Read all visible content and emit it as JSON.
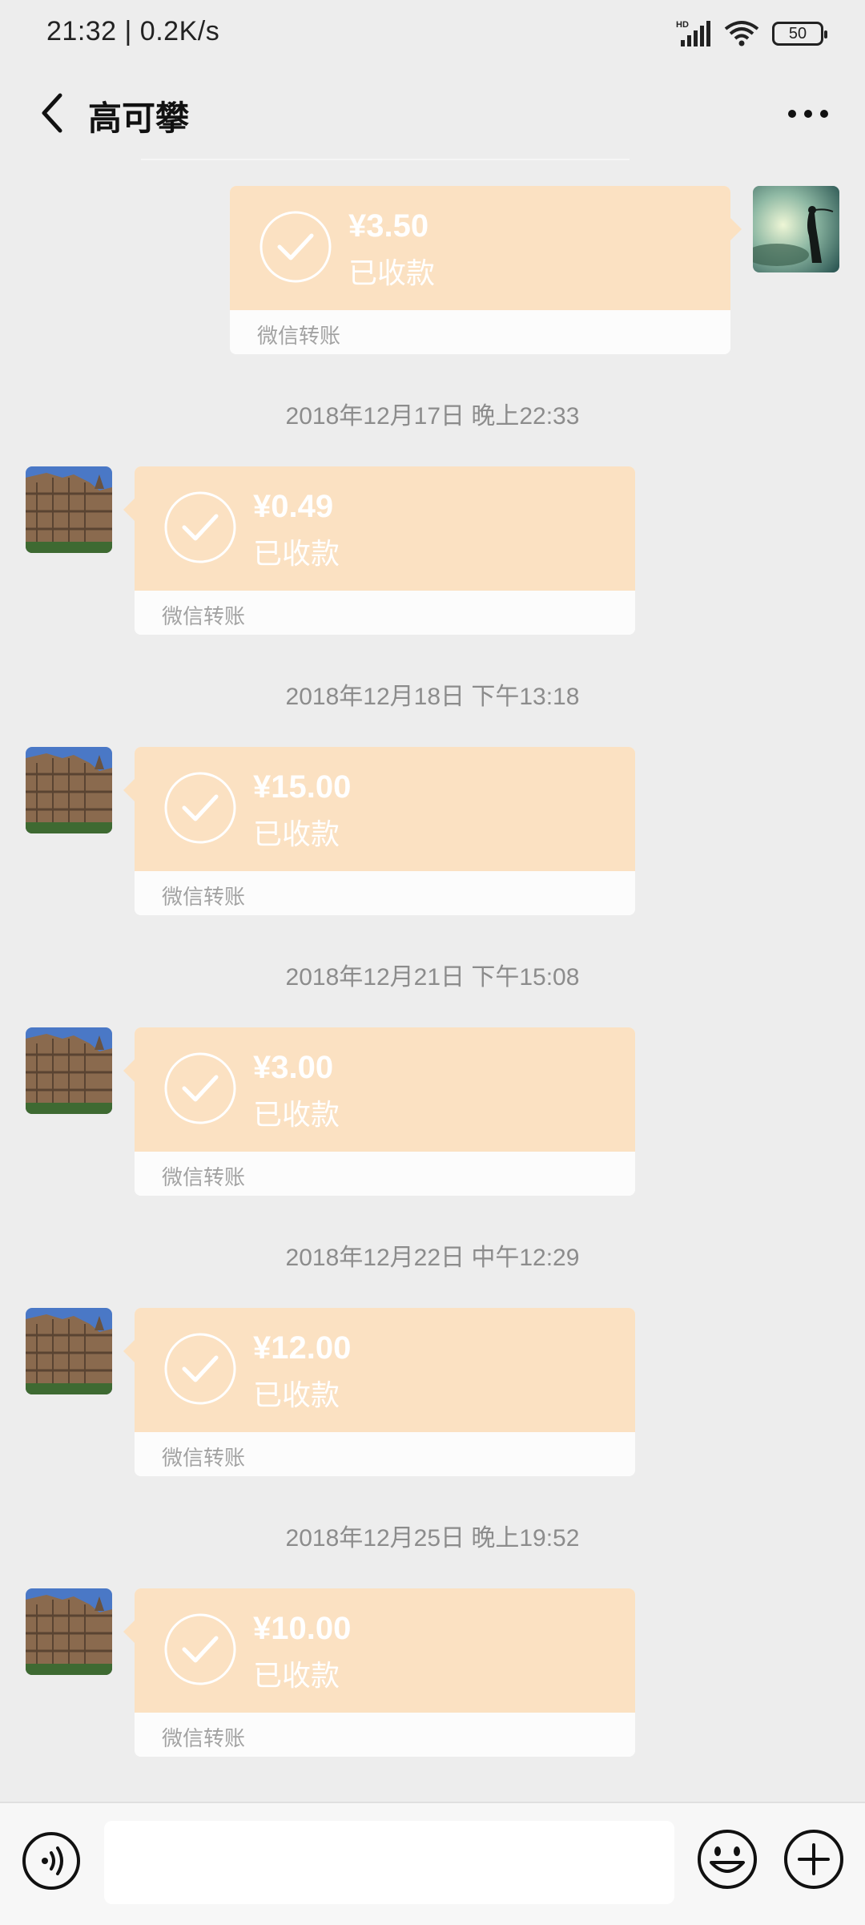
{
  "status_bar": {
    "time_speed": "21:32 | 0.2K/s",
    "battery": "50",
    "network_badge": "HD"
  },
  "header": {
    "title": "高可攀"
  },
  "messages": [
    {
      "amount": "¥3.50",
      "status": "已收款",
      "label": "微信转账"
    },
    {
      "timestamp": "2018年12月17日 晚上22:33",
      "amount": "¥0.49",
      "status": "已收款",
      "label": "微信转账"
    },
    {
      "timestamp": "2018年12月18日 下午13:18",
      "amount": "¥15.00",
      "status": "已收款",
      "label": "微信转账"
    },
    {
      "timestamp": "2018年12月21日 下午15:08",
      "amount": "¥3.00",
      "status": "已收款",
      "label": "微信转账"
    },
    {
      "timestamp": "2018年12月22日 中午12:29",
      "amount": "¥12.00",
      "status": "已收款",
      "label": "微信转账"
    },
    {
      "timestamp": "2018年12月25日 晚上19:52",
      "amount": "¥10.00",
      "status": "已收款",
      "label": "微信转账"
    }
  ],
  "input": {
    "value": ""
  },
  "colors": {
    "background": "#ededed",
    "transfer_bubble": "#fbe1c2",
    "timestamp_text": "#8c8c8c"
  },
  "icons": [
    "back-arrow-icon",
    "more-dots-icon",
    "voice-icon",
    "emoji-icon",
    "plus-icon",
    "check-icon",
    "signal-icon",
    "wifi-icon",
    "battery-icon"
  ]
}
